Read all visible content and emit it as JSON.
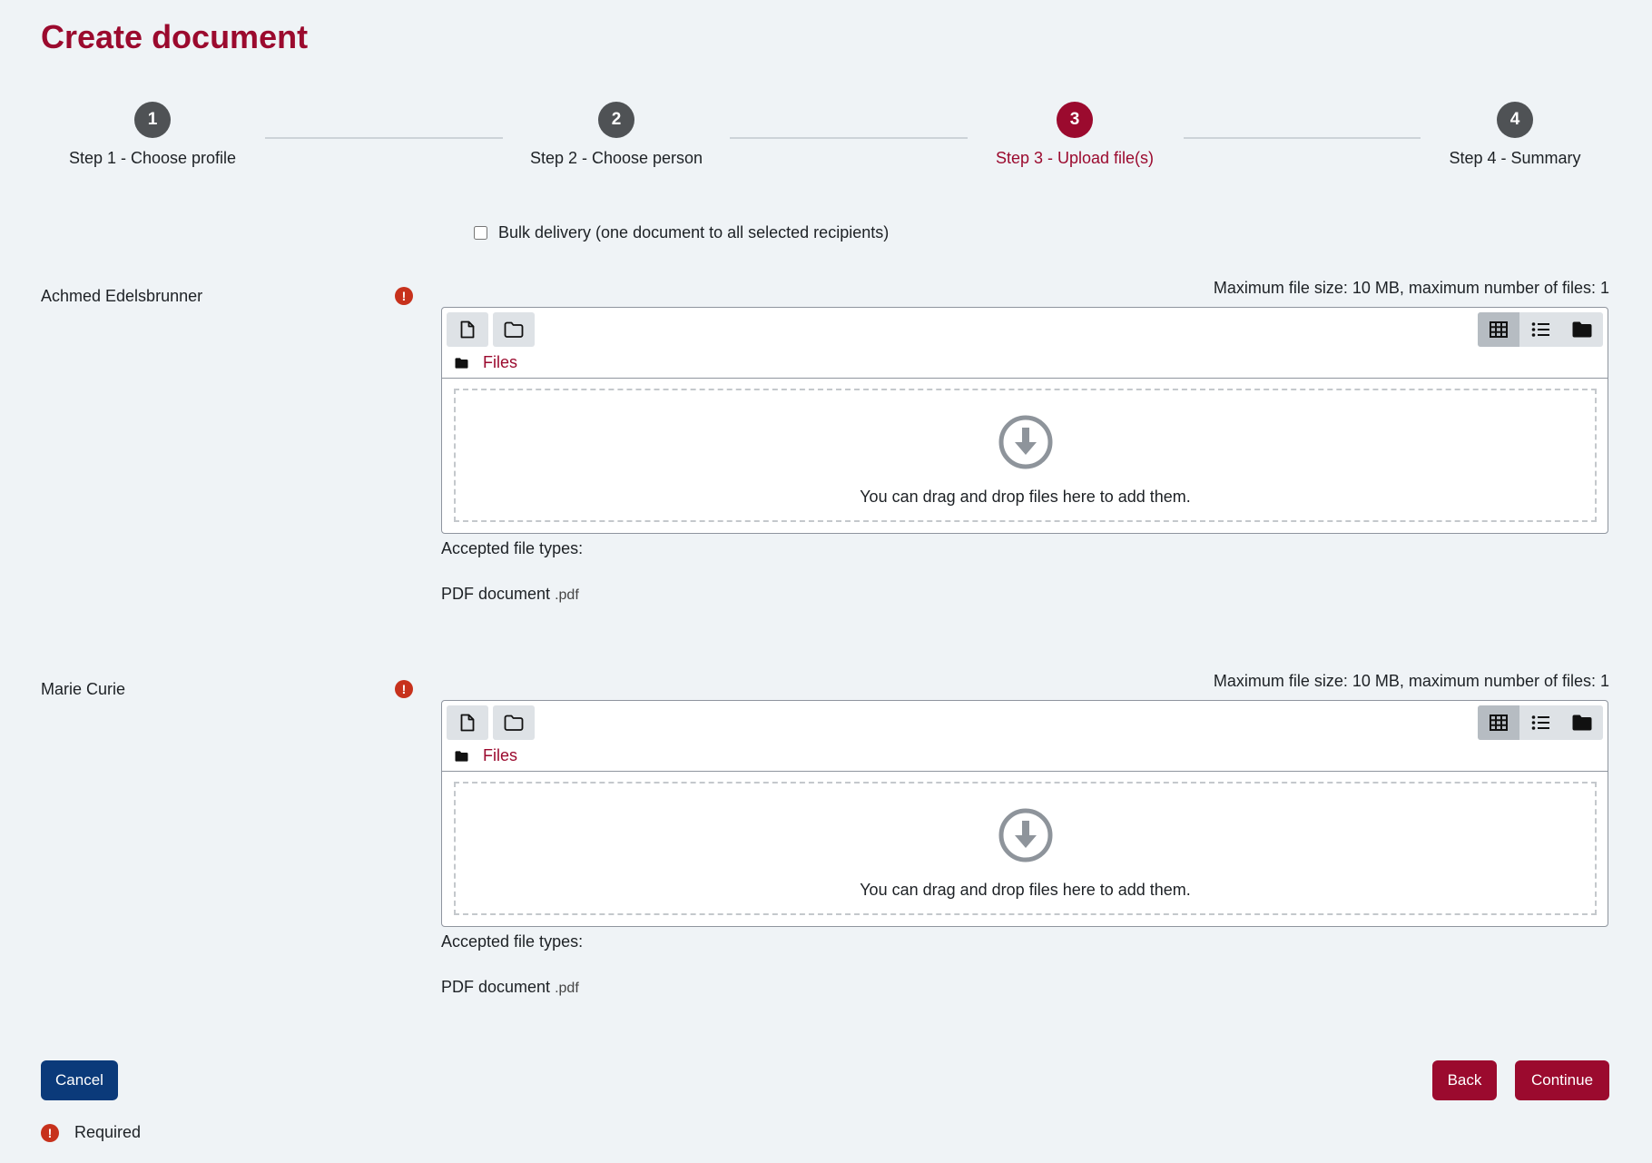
{
  "page": {
    "title": "Create document"
  },
  "stepper": {
    "steps": [
      {
        "number": "1",
        "label": "Step 1 - Choose profile"
      },
      {
        "number": "2",
        "label": "Step 2 - Choose person"
      },
      {
        "number": "3",
        "label": "Step 3 - Upload file(s)",
        "active": true
      },
      {
        "number": "4",
        "label": "Step 4 - Summary"
      }
    ]
  },
  "bulk": {
    "label": "Bulk delivery (one document to all selected recipients)",
    "checked": false
  },
  "recipients": [
    {
      "name": "Achmed Edelsbrunner",
      "required_icon": "!",
      "max_info": "Maximum file size: 10 MB, maximum number of files: 1",
      "path_label": "Files",
      "drop_text": "You can drag and drop files here to add them.",
      "accepted_label": "Accepted file types:",
      "file_type": "PDF document",
      "file_ext": ".pdf"
    },
    {
      "name": "Marie Curie",
      "required_icon": "!",
      "max_info": "Maximum file size: 10 MB, maximum number of files: 1",
      "path_label": "Files",
      "drop_text": "You can drag and drop files here to add them.",
      "accepted_label": "Accepted file types:",
      "file_type": "PDF document",
      "file_ext": ".pdf"
    }
  ],
  "icons": {
    "add_file": "file-icon",
    "create_folder": "folder-outline-icon",
    "view_grid": "grid-icon",
    "view_list": "list-icon",
    "view_tree": "folder-icon",
    "drop": "arrow-down-circle-icon",
    "required": "exclamation-circle-icon"
  },
  "colors": {
    "accent": "#9b0a2e",
    "primary": "#0b3a7a",
    "required": "#c7311c",
    "background": "#eff3f6"
  },
  "buttons": {
    "cancel": "Cancel",
    "back": "Back",
    "continue": "Continue"
  },
  "legend": {
    "icon": "!",
    "label": "Required"
  }
}
